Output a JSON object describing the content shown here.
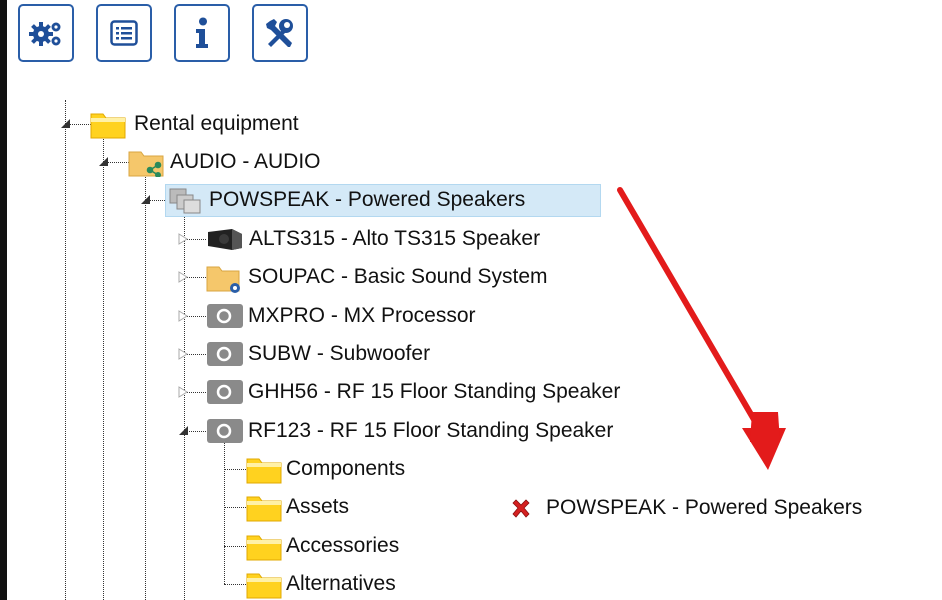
{
  "toolbar": {
    "buttons": [
      {
        "name": "settings-gears-button",
        "icon": "gears-icon"
      },
      {
        "name": "list-view-button",
        "icon": "list-icon"
      },
      {
        "name": "info-button",
        "icon": "info-icon"
      },
      {
        "name": "tools-button",
        "icon": "wrench-screwdriver-icon"
      }
    ]
  },
  "tree": {
    "root": "Rental equipment",
    "audio": "AUDIO - AUDIO",
    "powspeak": "POWSPEAK - Powered Speakers",
    "items": [
      {
        "label": "ALTS315 - Alto TS315 Speaker",
        "icon": "speaker-icon"
      },
      {
        "label": "SOUPAC - Basic Sound System",
        "icon": "folder-gear-icon"
      },
      {
        "label": "MXPRO - MX Processor",
        "icon": "component-icon"
      },
      {
        "label": "SUBW - Subwoofer",
        "icon": "component-icon"
      },
      {
        "label": "GHH56 - RF 15 Floor Standing Speaker",
        "icon": "component-icon"
      },
      {
        "label": "RF123 - RF 15 Floor Standing Speaker",
        "icon": "component-icon"
      }
    ],
    "rf123_children": [
      "Components",
      "Assets",
      "Accessories",
      "Alternatives"
    ]
  },
  "drag": {
    "label": "POWSPEAK - Powered Speakers",
    "status_icon": "red-x-icon",
    "arrow_color": "#e31b1b"
  },
  "colors": {
    "folder": "#ffd21f",
    "selection": "#d4e9f7",
    "toolbar_border": "#2a5ea8"
  }
}
